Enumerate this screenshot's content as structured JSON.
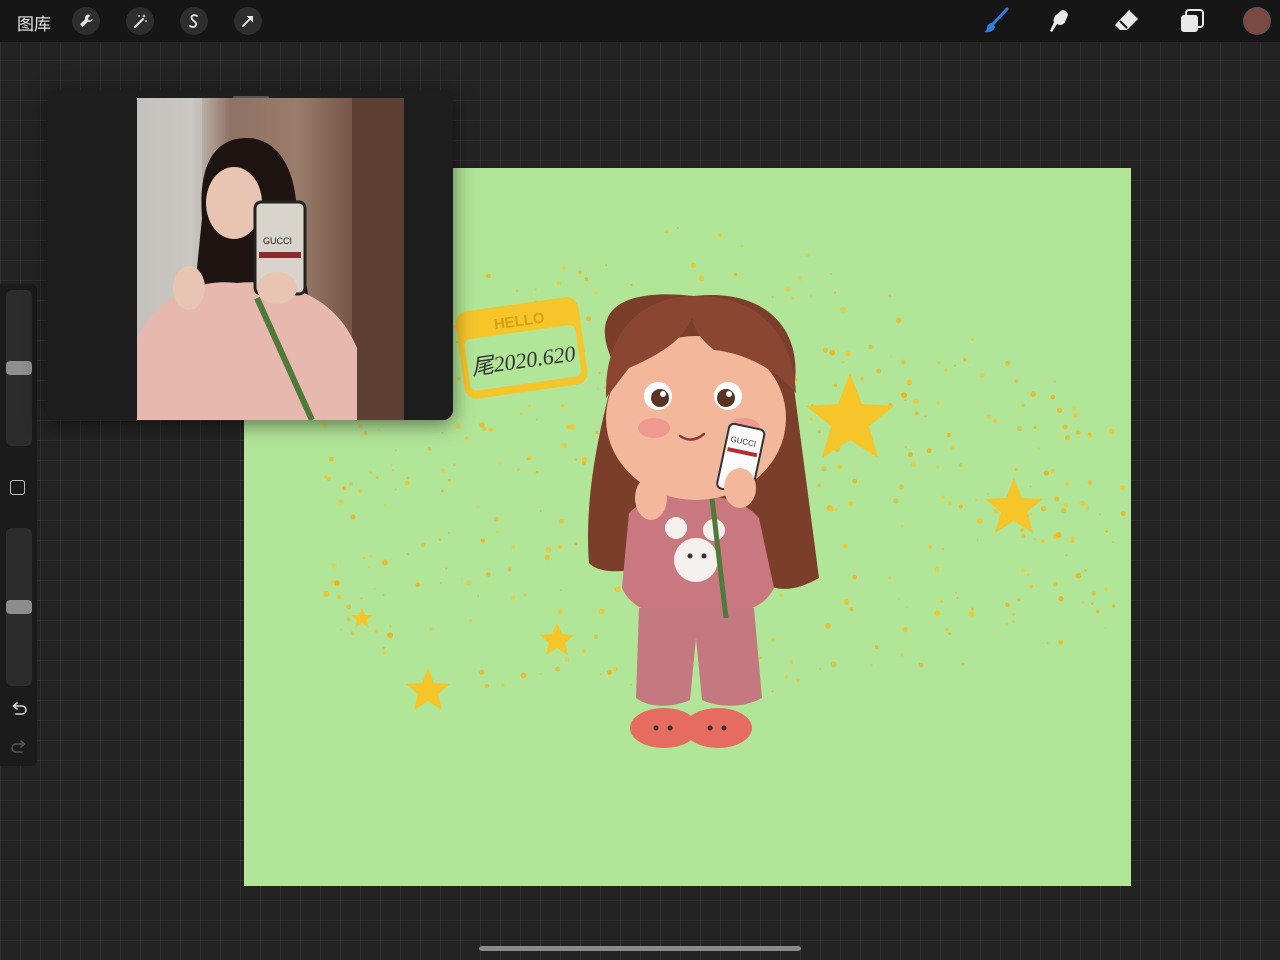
{
  "toolbar": {
    "gallery_label": "图库",
    "left_tools": [
      {
        "name": "wrench-icon",
        "label": "Actions"
      },
      {
        "name": "magic-wand-icon",
        "label": "Adjustments"
      },
      {
        "name": "selection-icon",
        "label": "Selection"
      },
      {
        "name": "arrow-cursor-icon",
        "label": "Transform"
      }
    ],
    "right_tools": [
      {
        "name": "brush-icon",
        "active": true
      },
      {
        "name": "smudge-icon",
        "active": false
      },
      {
        "name": "eraser-icon",
        "active": false
      },
      {
        "name": "layers-icon",
        "active": false
      }
    ],
    "active_color": "#7a4a42",
    "accent_color": "#2f7fe0"
  },
  "sidebar": {
    "brush_size_level": 0.5,
    "opacity_level": 0.5
  },
  "canvas": {
    "background": "#b1e598",
    "badge_title": "HELLO",
    "badge_signature": "尾2020.620",
    "phone_case_text": "GUCCI"
  },
  "reference": {
    "phone_case_text": "GUCCI"
  }
}
